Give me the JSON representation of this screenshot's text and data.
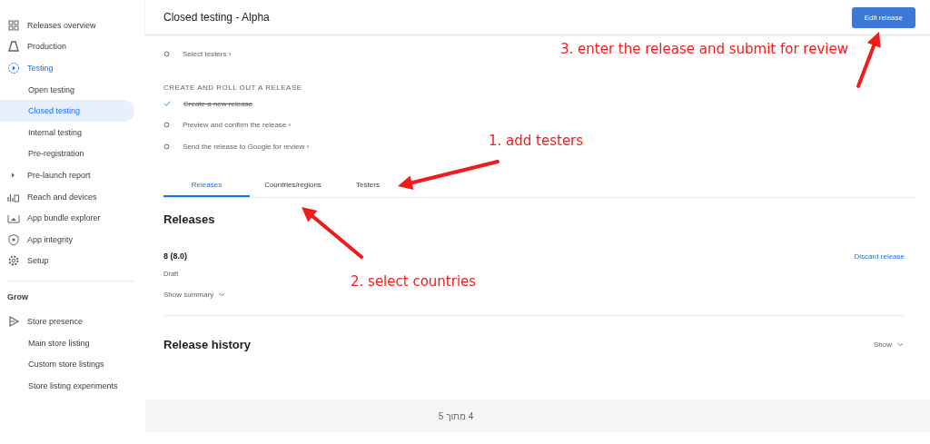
{
  "sidebar": {
    "items": [
      {
        "label": "Releases overview",
        "kind": "grid",
        "selected": false
      },
      {
        "label": "Production",
        "kind": "production",
        "selected": false
      },
      {
        "label": "Testing",
        "kind": "play",
        "selected": false,
        "expanded": true,
        "children": [
          {
            "label": "Open testing",
            "selected": false
          },
          {
            "label": "Closed testing",
            "selected": true
          },
          {
            "label": "Internal testing",
            "selected": false
          },
          {
            "label": "Pre-registration",
            "selected": false
          }
        ]
      },
      {
        "label": "Pre-launch report",
        "kind": "caret",
        "selected": false
      },
      {
        "label": "Reach and devices",
        "kind": "bars",
        "selected": false
      },
      {
        "label": "App bundle explorer",
        "kind": "bundle",
        "selected": false
      },
      {
        "label": "App integrity",
        "kind": "shield",
        "selected": false
      },
      {
        "label": "Setup",
        "kind": "gear",
        "selected": false
      }
    ],
    "section": "Grow",
    "grow_items": [
      {
        "label": "Store presence",
        "kind": "store",
        "selected": false,
        "expanded": true,
        "children": [
          {
            "label": "Main store listing",
            "selected": false
          },
          {
            "label": "Custom store listings",
            "selected": false
          },
          {
            "label": "Store listing experiments",
            "selected": false
          }
        ]
      }
    ]
  },
  "header": {
    "title": "Closed testing - Alpha",
    "button": "Edit release"
  },
  "steps_top": [
    {
      "label": "Select testers ›",
      "done": false
    }
  ],
  "steps_section": "CREATE AND ROLL OUT A RELEASE",
  "steps": [
    {
      "label": "Create a new release",
      "done": true
    },
    {
      "label": "Preview and confirm the release ›",
      "done": false
    },
    {
      "label": "Send the release to Google for review ›",
      "done": false
    }
  ],
  "tabs": [
    {
      "label": "Releases",
      "selected": true
    },
    {
      "label": "Countries/regions",
      "selected": false
    },
    {
      "label": "Testers",
      "selected": false
    }
  ],
  "releases": {
    "heading": "Releases",
    "version": "8 (8.0)",
    "status": "Draft",
    "summary": "Show summary",
    "discard": "Discard release"
  },
  "history": {
    "heading": "Release history",
    "show": "Show"
  },
  "pager": "4 מתוך 5",
  "annotations": [
    "1. add testers",
    "2. select countries",
    "3. enter the release and submit for review"
  ]
}
